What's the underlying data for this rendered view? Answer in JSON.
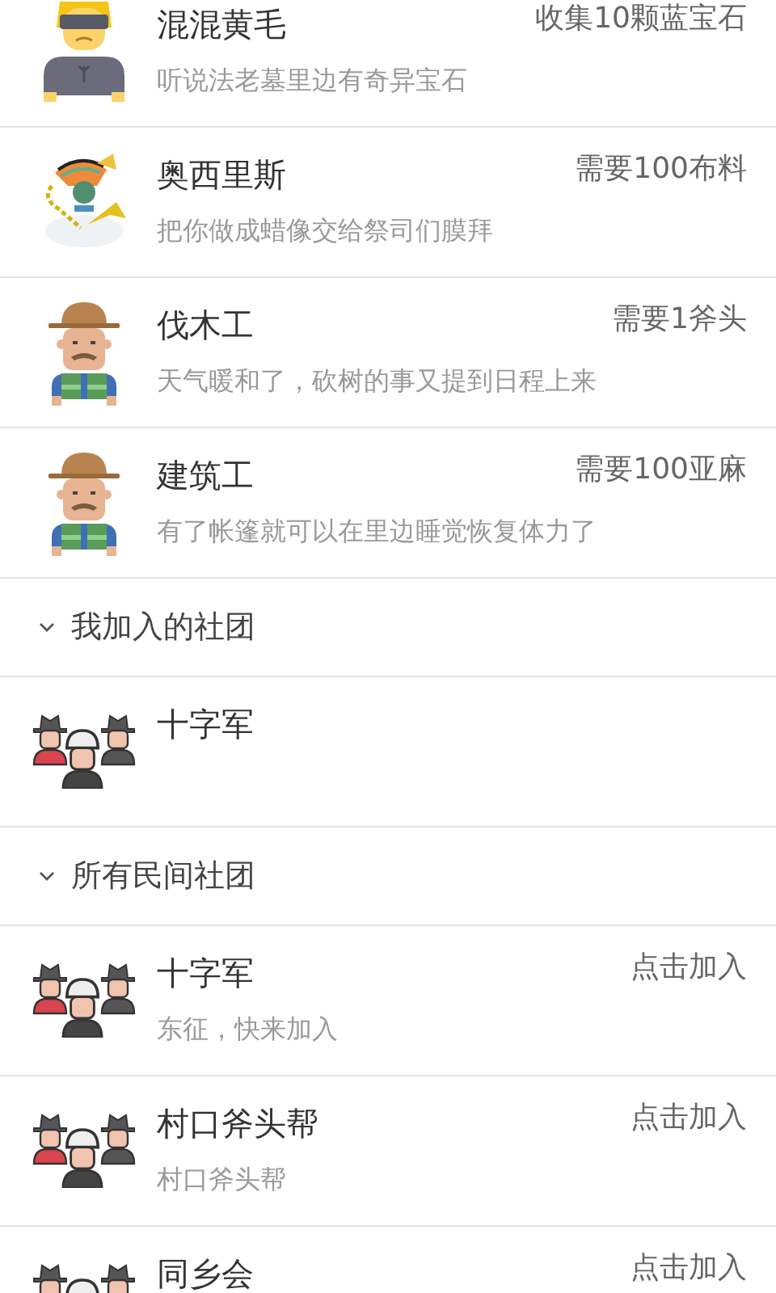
{
  "quests": [
    {
      "kind": "punk",
      "name": "混混黄毛",
      "requirement": "收集10颗蓝宝石",
      "description": "听说法老墓里边有奇异宝石"
    },
    {
      "kind": "pharaoh",
      "name": "奥西里斯",
      "requirement": "需要100布料",
      "description": "把你做成蜡像交给祭司们膜拜"
    },
    {
      "kind": "worker",
      "name": "伐木工",
      "requirement": "需要1斧头",
      "description": "天气暖和了，砍树的事又提到日程上来"
    },
    {
      "kind": "worker",
      "name": "建筑工",
      "requirement": "需要100亚麻",
      "description": "有了帐篷就可以在里边睡觉恢复体力了"
    }
  ],
  "sections": [
    {
      "title": "我加入的社团",
      "expanded": true,
      "items": [
        {
          "kind": "group",
          "name": "十字军"
        }
      ]
    },
    {
      "title": "所有民间社团",
      "expanded": true,
      "items": [
        {
          "kind": "group",
          "name": "十字军",
          "action": "点击加入",
          "description": "东征，快来加入"
        },
        {
          "kind": "group",
          "name": "村口斧头帮",
          "action": "点击加入",
          "description": "村口斧头帮"
        },
        {
          "kind": "group",
          "name": "同乡会",
          "action": "点击加入"
        }
      ]
    }
  ]
}
